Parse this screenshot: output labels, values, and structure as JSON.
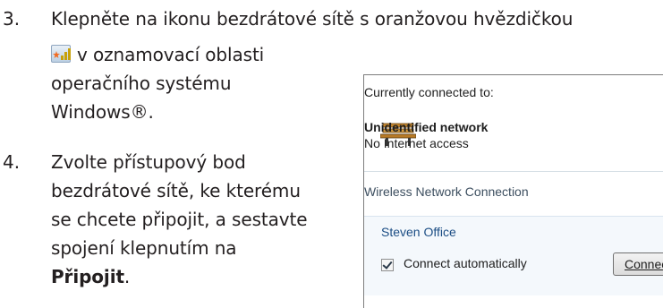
{
  "steps": [
    {
      "number": "3.",
      "line1": "Klepněte na ikonu bezdrátové sítě s oranžovou hvězdičkou",
      "line2": "v oznamovací oblasti",
      "line3": "operačního systému",
      "line4": "Windows®."
    },
    {
      "number": "4.",
      "line1": "Zvolte přístupový bod",
      "line2": "bezdrátové sítě, ke kterému",
      "line3": "se chcete připojit, a sestavte",
      "line4": "spojení klepnutím na",
      "line5": "Připojit",
      "line5_suffix": "."
    }
  ],
  "panel": {
    "header": "Currently connected to:",
    "network_name": "Unidentified network",
    "network_status": "No Internet access",
    "section_title": "Wireless Network Connection",
    "selected_network": "Steven Office",
    "auto_connect_label": "Connect automatically",
    "auto_connect_checked": true,
    "connect_button": "Connect"
  },
  "icons": {
    "tray": "wireless-network-orange-star-icon",
    "network": "bench-network-icon"
  }
}
